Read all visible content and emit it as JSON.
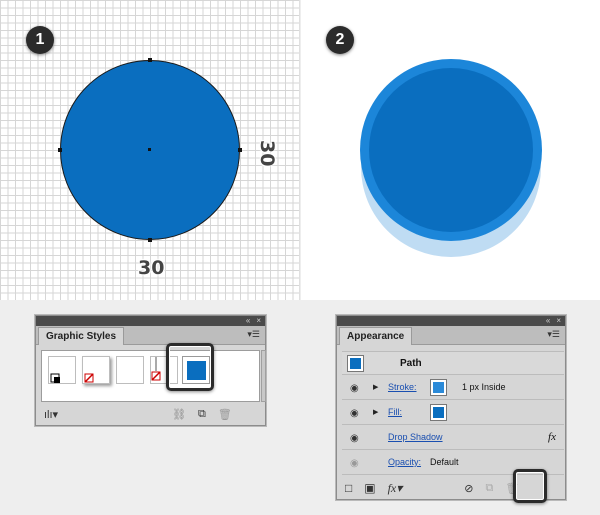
{
  "steps": {
    "step1": "1",
    "step2": "2"
  },
  "dimensions": {
    "width_label": "30",
    "height_label": "30"
  },
  "colors": {
    "circle_fill": "#0a6ebf",
    "ring_outer": "#1c86d9",
    "shadow": "#bfdcf3",
    "badge_bg": "#2b2b2b"
  },
  "graphic_styles": {
    "tab_label": "Graphic Styles",
    "panel_controls": [
      "«",
      "×"
    ],
    "menu_icon": "panel-menu-icon",
    "footer_icons": [
      "library-icon",
      "break-link-icon",
      "new-style-icon",
      "trash-icon"
    ],
    "swatch_count": 5,
    "selected_swatch_index": 4
  },
  "appearance": {
    "tab_label": "Appearance",
    "panel_controls": [
      "«",
      "×"
    ],
    "header_label": "Path",
    "rows": [
      {
        "label": "Stroke:",
        "value": "1 px  Inside"
      },
      {
        "label": "Fill:",
        "value": ""
      },
      {
        "label": "Drop Shadow",
        "value": "fx"
      },
      {
        "label": "Opacity:",
        "value": "Default"
      }
    ],
    "footer_icons": [
      "add-stroke-icon",
      "add-fill-icon",
      "fx-icon",
      "clear-appearance-icon",
      "duplicate-icon",
      "trash-icon"
    ],
    "fx_glyph": "fx"
  }
}
